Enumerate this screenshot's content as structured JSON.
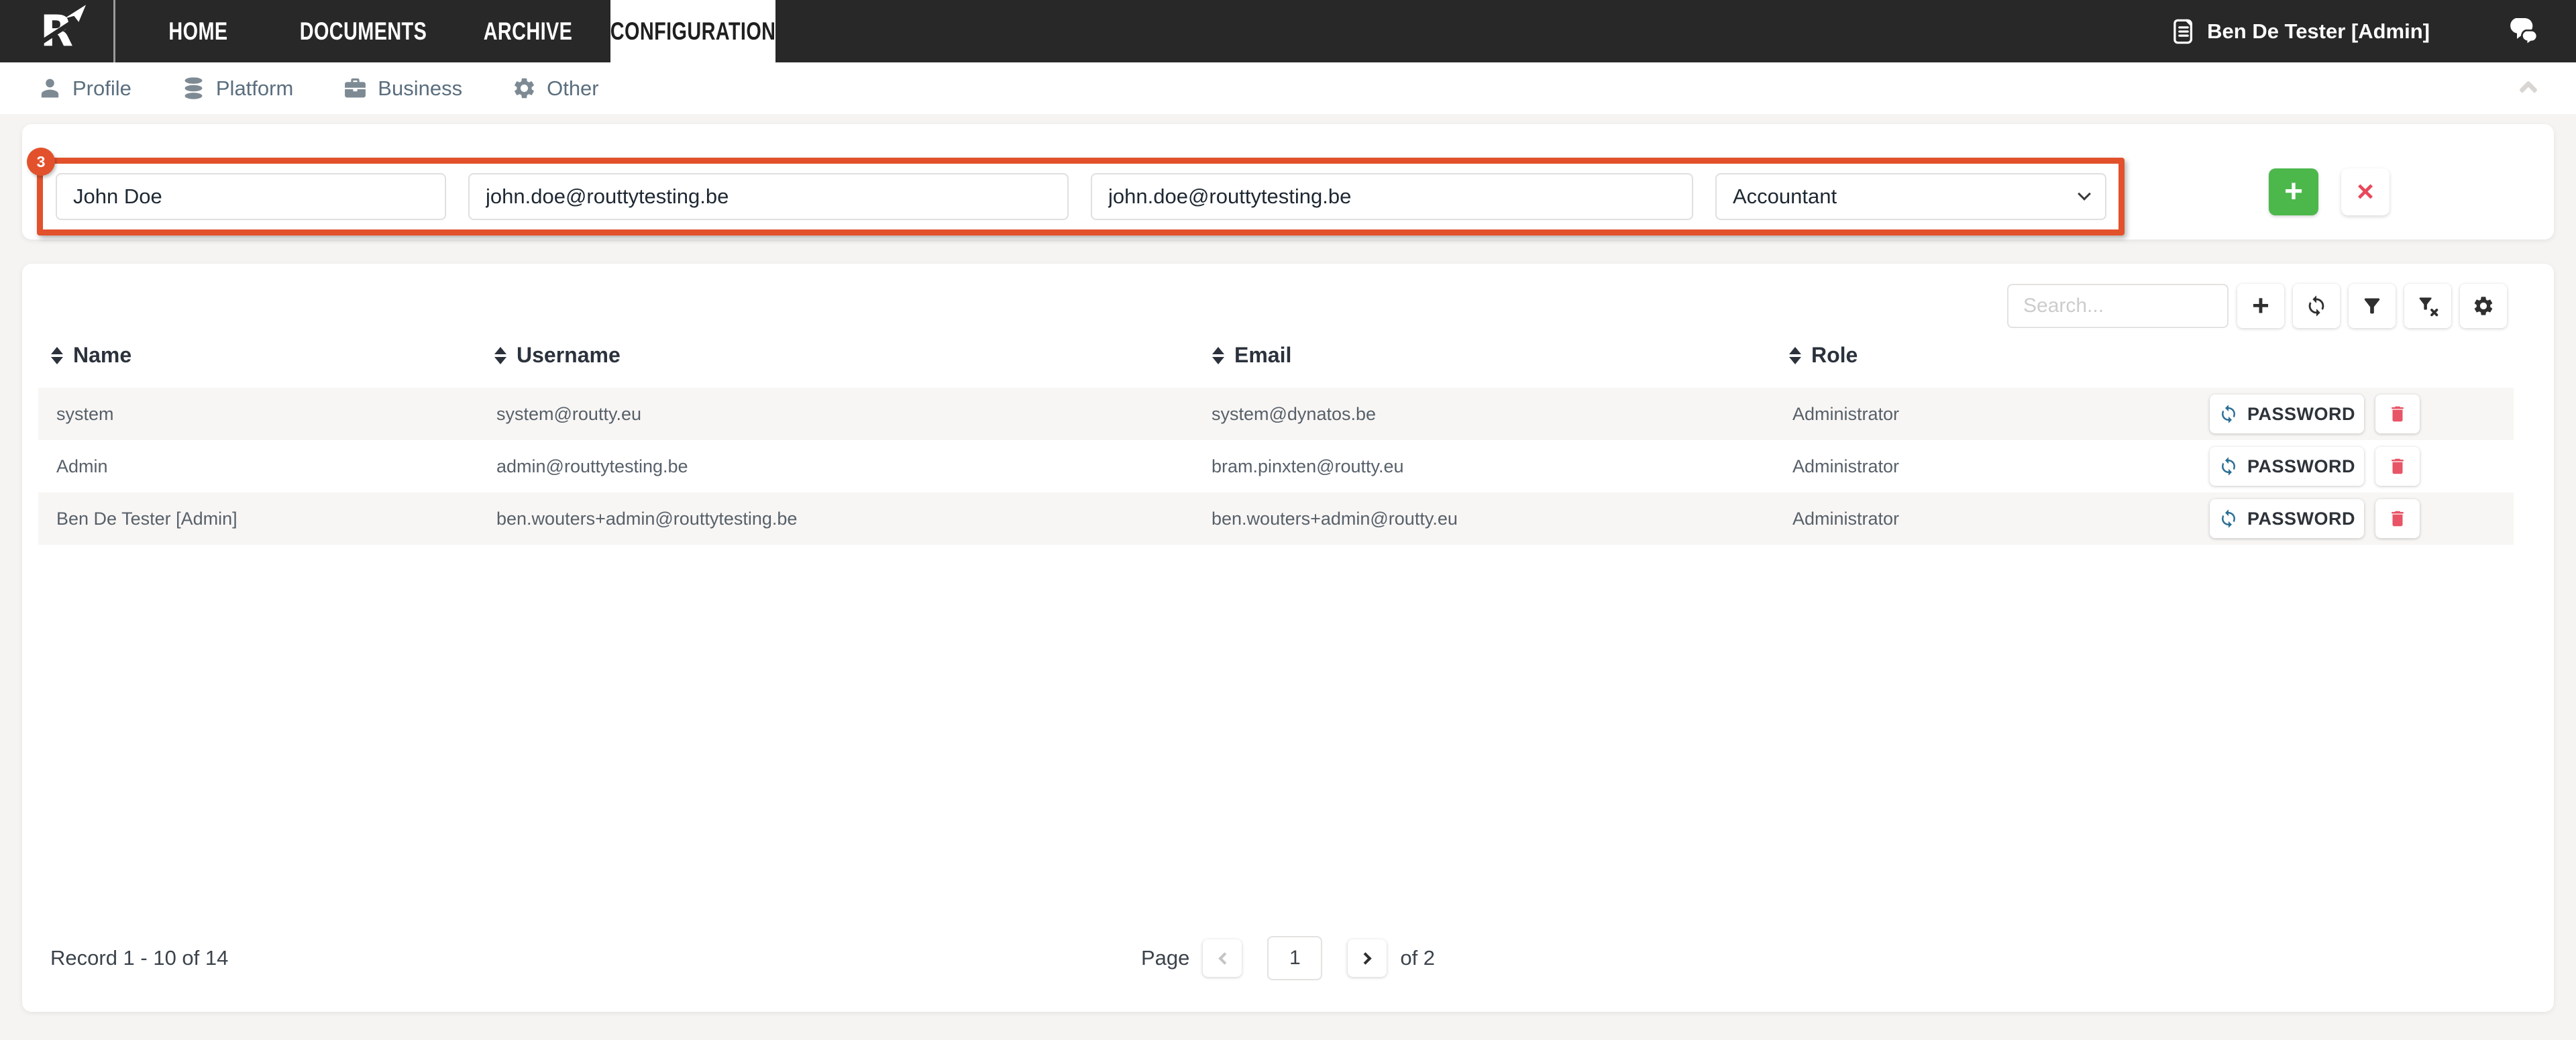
{
  "navbar": {
    "logo_letter": "R",
    "tabs": [
      {
        "label": "HOME",
        "active": false
      },
      {
        "label": "DOCUMENTS",
        "active": false
      },
      {
        "label": "ARCHIVE",
        "active": false
      },
      {
        "label": "CONFIGURATION",
        "active": true
      }
    ],
    "user_name": "Ben De Tester [Admin]"
  },
  "subnav": {
    "items": [
      {
        "label": "Profile",
        "icon": "person-icon"
      },
      {
        "label": "Platform",
        "icon": "database-icon"
      },
      {
        "label": "Business",
        "icon": "briefcase-icon"
      },
      {
        "label": "Other",
        "icon": "gear-icon"
      }
    ]
  },
  "user_form": {
    "step_badge": "3",
    "name_value": "John Doe",
    "username_value": "john.doe@routtytesting.be",
    "email_value": "john.doe@routtytesting.be",
    "role_value": "Accountant",
    "add_label": "+",
    "cancel_label": "×"
  },
  "users_table": {
    "search_placeholder": "Search...",
    "columns": [
      "Name",
      "Username",
      "Email",
      "Role"
    ],
    "rows": [
      {
        "name": "system",
        "username": "system@routty.eu",
        "email": "system@dynatos.be",
        "role": "Administrator"
      },
      {
        "name": "Admin",
        "username": "admin@routtytesting.be",
        "email": "bram.pinxten@routty.eu",
        "role": "Administrator"
      },
      {
        "name": "Ben De Tester [Admin]",
        "username": "ben.wouters+admin@routtytesting.be",
        "email": "ben.wouters+admin@routty.eu",
        "role": "Administrator"
      }
    ],
    "password_button_label": "PASSWORD",
    "record_text": "Record 1 - 10 of 14",
    "pagination": {
      "page_label": "Page",
      "current_page": "1",
      "of_text": "of 2"
    }
  },
  "colors": {
    "navbar_bg": "#282828",
    "annotation_orange": "#e2512b",
    "add_green": "#4cb84c",
    "cancel_red": "#e8495a",
    "trash_red": "#e85567",
    "refresh_blue": "#2c6f96",
    "page_bg": "#f6f4f2",
    "row_stripe": "#f8f6f4"
  }
}
